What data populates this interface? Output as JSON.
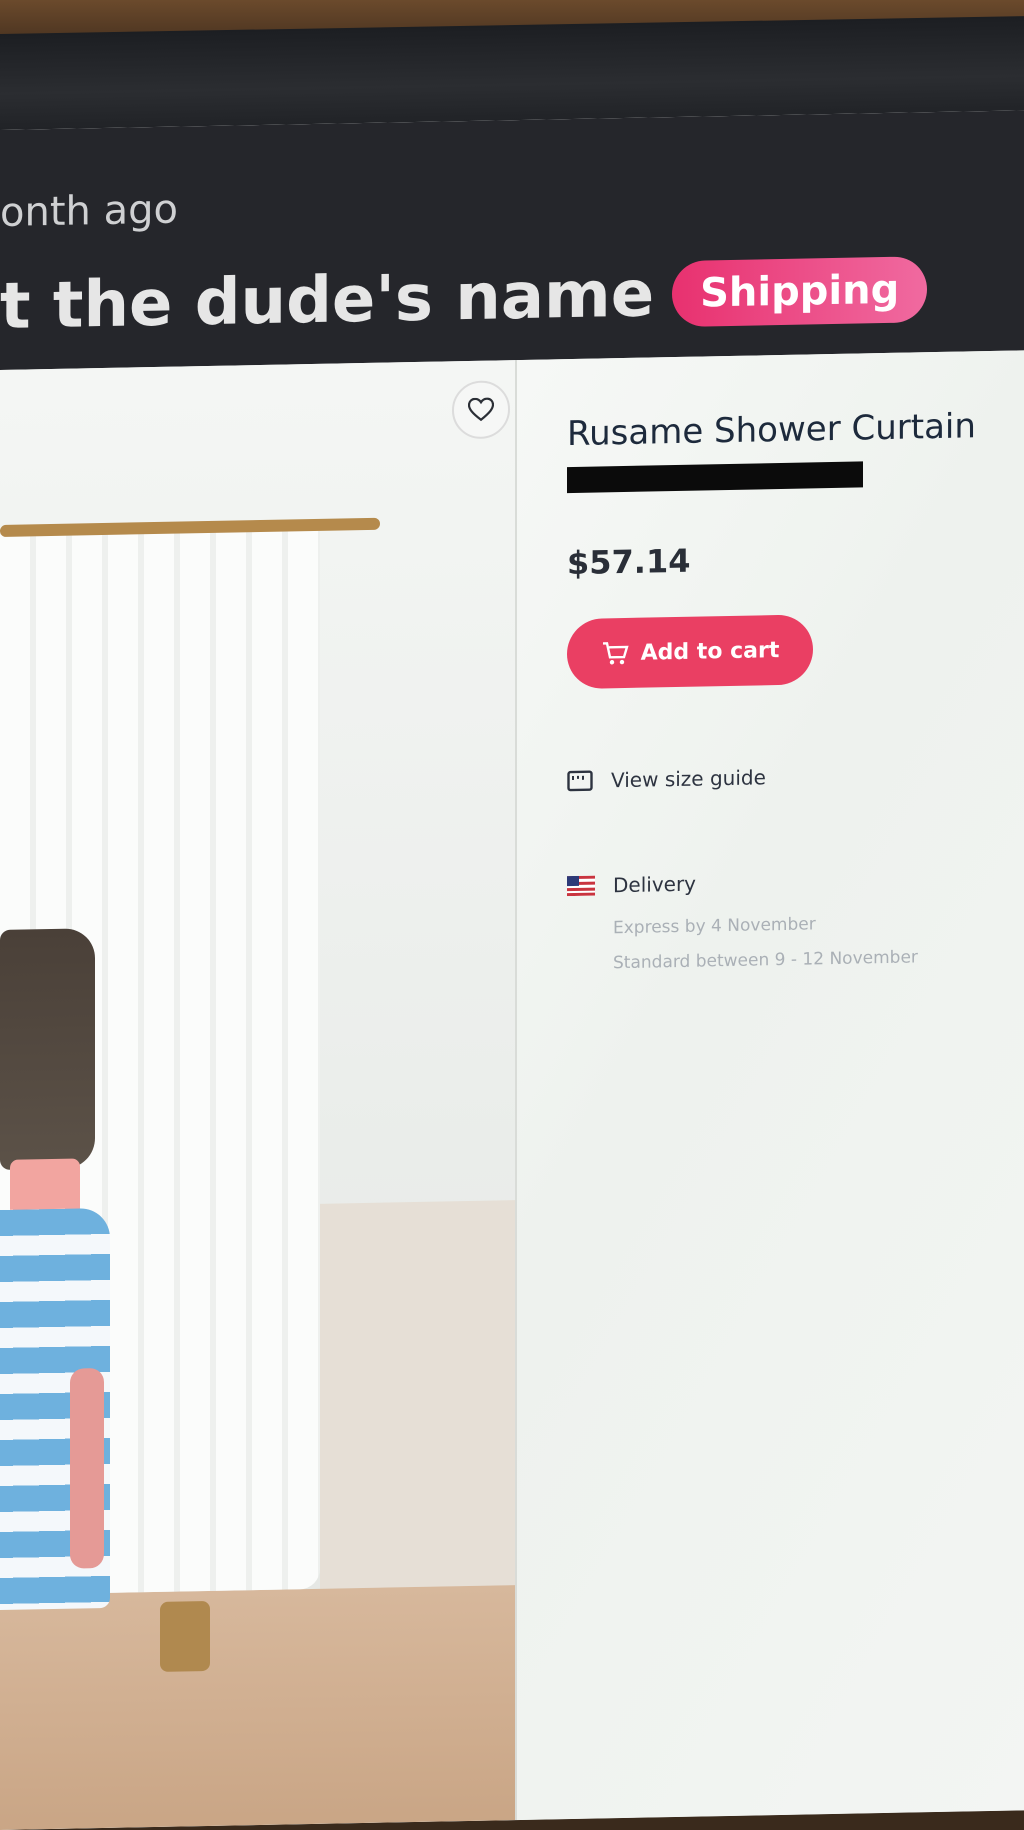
{
  "post": {
    "time_ago": "onth ago",
    "title": "t the dude's name",
    "badge": "Shipping"
  },
  "product": {
    "name": "Rusame Shower Curtain",
    "price": "$57.14",
    "add_to_cart": "Add to cart",
    "size_guide": "View size guide",
    "delivery": {
      "label": "Delivery",
      "express": "Express by 4 November",
      "standard": "Standard between 9 - 12 November"
    }
  },
  "colors": {
    "accent": "#ea3f63",
    "header_bg": "#25262b",
    "badge": "#e8316f"
  },
  "icons": [
    "heart-icon",
    "cart-icon",
    "ruler-icon",
    "us-flag-icon"
  ]
}
